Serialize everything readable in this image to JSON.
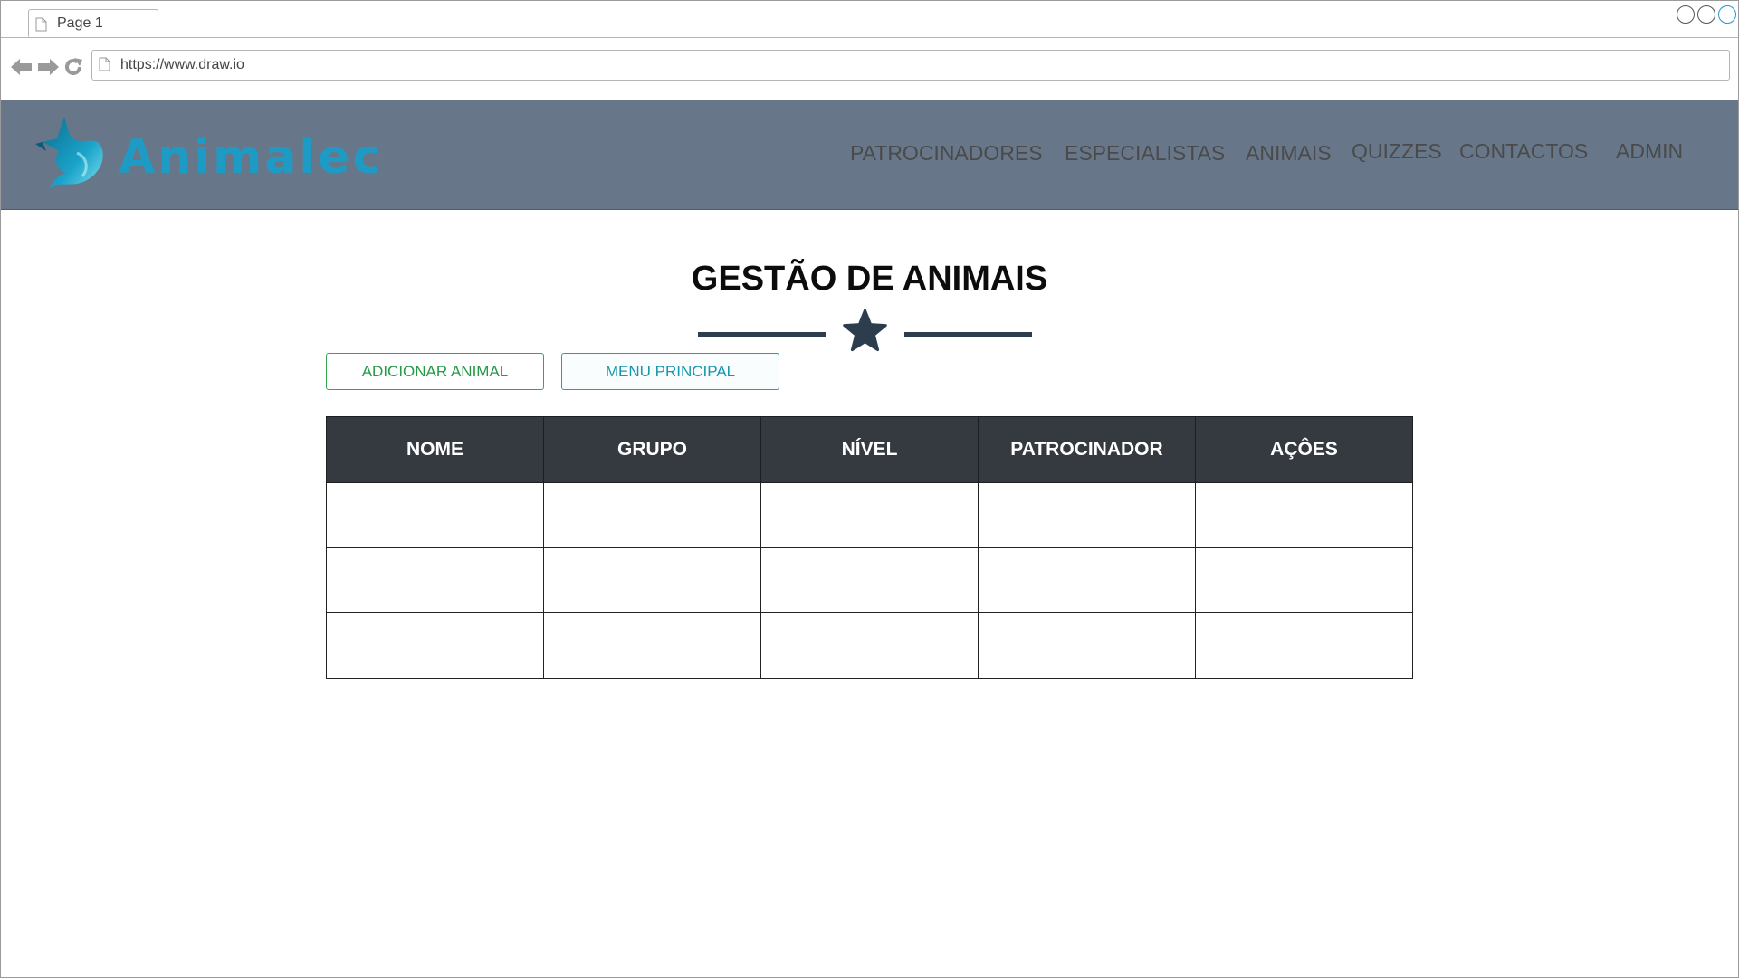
{
  "browser": {
    "tab_label": "Page 1",
    "url": "https://www.draw.io"
  },
  "header": {
    "logo_text": "Animalec",
    "nav": [
      "PATROCINADORES",
      "ESPECIALISTAS",
      "ANIMAIS",
      "QUIZZES",
      "CONTACTOS",
      "ADMIN"
    ]
  },
  "main": {
    "title": "GESTÃO DE ANIMAIS",
    "buttons": {
      "add_label": "ADICIONAR ANIMAL",
      "menu_label": "MENU PRINCIPAL"
    },
    "table": {
      "columns": [
        "NOME",
        "GRUPO",
        "NÍVEL",
        "PATROCINADOR",
        "AÇÔES"
      ],
      "rows": [
        [
          "",
          "",
          "",
          "",
          ""
        ],
        [
          "",
          "",
          "",
          "",
          ""
        ],
        [
          "",
          "",
          "",
          "",
          ""
        ]
      ]
    }
  },
  "colors": {
    "header_bg": "#677789",
    "logo_accent": "#1e9bc4",
    "table_header_bg": "#343a40",
    "add_button": "#32a852",
    "menu_button": "#1aa1b8",
    "divider": "#2e3d4d"
  },
  "icons": {
    "logo": "fox-logo-icon",
    "divider": "star-icon"
  }
}
